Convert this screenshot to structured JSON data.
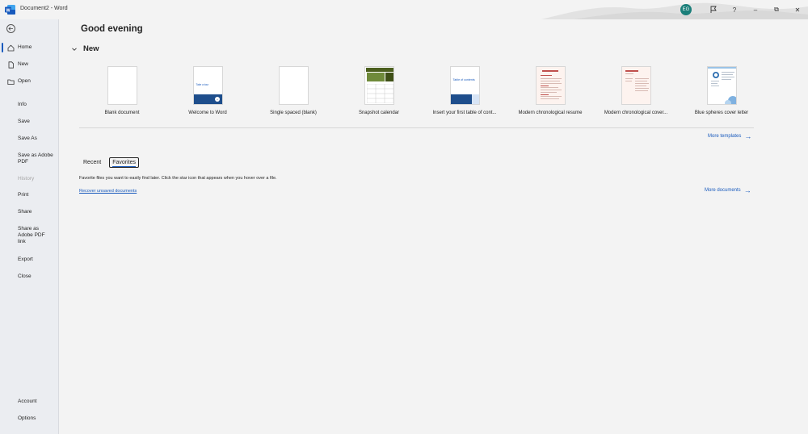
{
  "window": {
    "title": "Document2 - Word",
    "avatar_initials": "EG",
    "help_label": "?",
    "minimize_label": "–",
    "restore_label": "⧉",
    "close_label": "✕"
  },
  "sidebar": {
    "items": [
      {
        "label": "Home",
        "icon": "home-icon"
      },
      {
        "label": "New",
        "icon": "new-document-icon"
      },
      {
        "label": "Open",
        "icon": "folder-icon"
      },
      {
        "label": "Info"
      },
      {
        "label": "Save"
      },
      {
        "label": "Save As"
      },
      {
        "label": "Save as Adobe PDF"
      },
      {
        "label": "History"
      },
      {
        "label": "Print"
      },
      {
        "label": "Share"
      },
      {
        "label": "Share as Adobe PDF link"
      },
      {
        "label": "Export"
      },
      {
        "label": "Close"
      },
      {
        "label": "Account"
      },
      {
        "label": "Options"
      }
    ]
  },
  "main": {
    "greeting": "Good evening",
    "new_label": "New",
    "templates": [
      {
        "name": "Blank document"
      },
      {
        "name": "Welcome to Word",
        "thumb_text": "Take a tour"
      },
      {
        "name": "Single spaced (blank)"
      },
      {
        "name": "Snapshot calendar"
      },
      {
        "name": "Insert your first table of cont...",
        "thumb_text": "Table of contents"
      },
      {
        "name": "Modern chronological resume"
      },
      {
        "name": "Modern chronological cover..."
      },
      {
        "name": "Blue spheres cover letter"
      }
    ],
    "more_templates": "More templates",
    "tabs": [
      {
        "label": "Recent"
      },
      {
        "label": "Favorites"
      }
    ],
    "favorites_info": "Favorite files you want to easily find later. Click the star icon that appears when you hover over a file.",
    "recover_link": "Recover unsaved documents",
    "more_documents": "More documents"
  },
  "colors": {
    "accent": "#185abd",
    "sidebar_bg": "#ebedf1",
    "page_bg": "#f3f3f3"
  }
}
